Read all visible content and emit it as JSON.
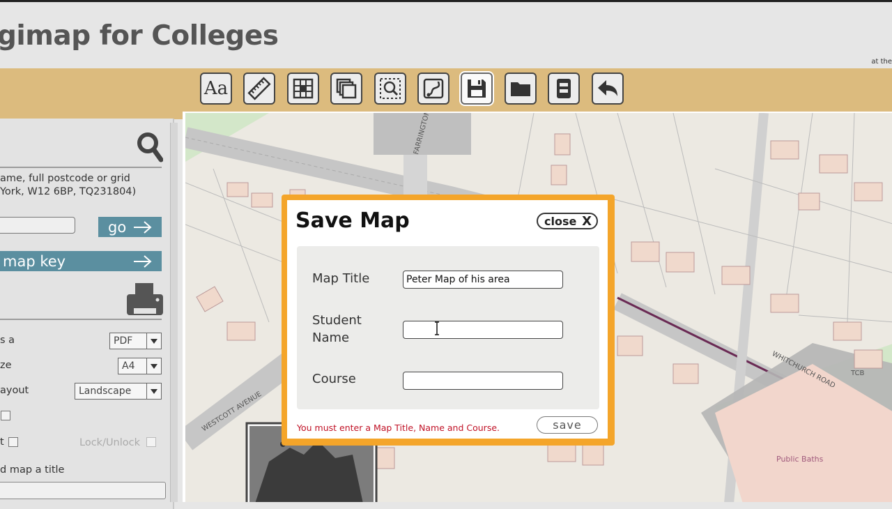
{
  "header": {
    "title": "gimap for Colleges",
    "right_text": "at the"
  },
  "toolbar": {
    "buttons": [
      {
        "icon": "text-icon",
        "glyph": "Aa"
      },
      {
        "icon": "ruler-icon"
      },
      {
        "icon": "grid-icon"
      },
      {
        "icon": "layers-icon"
      },
      {
        "icon": "zoom-area-icon"
      },
      {
        "icon": "route-icon"
      },
      {
        "icon": "save-icon",
        "active": true
      },
      {
        "icon": "folder-icon"
      },
      {
        "icon": "archive-icon"
      },
      {
        "icon": "back-arrow-icon"
      }
    ]
  },
  "sidebar": {
    "search_hint_line1": "ame, full postcode or grid",
    "search_hint_line2": "York, W12 6BP, TQ231804)",
    "go_label": "go",
    "map_key_label": "map key",
    "print_options": {
      "save_as_label": "s a",
      "save_as_value": "PDF",
      "size_label": "ze",
      "size_value": "A4",
      "layout_label": "ayout",
      "layout_value": "Landscape",
      "option4_label": "t",
      "lock_label": "Lock/Unlock",
      "title_prompt": "d map a title"
    }
  },
  "map": {
    "labels": {
      "farrington": "FARRINGTON AVENUE",
      "westcott": "WESTCOTT AVENUE",
      "whitchurch": "WHITCHURCH ROAD",
      "public_baths": "Public Baths",
      "tcb": "TCB"
    },
    "colors": {
      "road": "#c4c4c4",
      "building": "#f0d9cc",
      "grass": "#d3e7c9",
      "boundary": "#6a2a54"
    }
  },
  "dialog": {
    "title": "Save Map",
    "close_label": "close",
    "close_x": "X",
    "fields": {
      "map_title_label": "Map Title",
      "map_title_value": "Peter Map of his area",
      "student_label_line1": "Student",
      "student_label_line2": "Name",
      "student_value": "",
      "course_label": "Course",
      "course_value": ""
    },
    "error": "You must enter a Map Title, Name and Course.",
    "save_label": "save",
    "accent": "#f4a52a"
  }
}
